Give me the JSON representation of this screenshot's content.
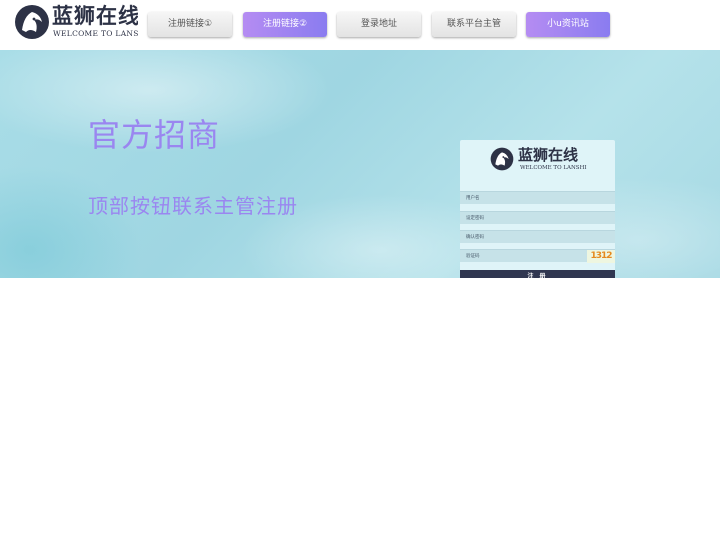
{
  "header": {
    "logo": {
      "title": "蓝狮在线",
      "subtitle": "WELCOME TO LANSHI"
    },
    "nav": [
      {
        "label": "注册链接①",
        "style": "gray"
      },
      {
        "label": "注册链接②",
        "style": "purple"
      },
      {
        "label": "登录地址",
        "style": "gray"
      },
      {
        "label": "联系平台主管",
        "style": "gray"
      },
      {
        "label": "小u资讯站",
        "style": "purple"
      }
    ]
  },
  "hero": {
    "title": "官方招商",
    "subtitle": "顶部按钮联系主管注册"
  },
  "form": {
    "logo": {
      "title": "蓝狮在线",
      "subtitle": "WELCOME TO LANSHI"
    },
    "fields": [
      {
        "placeholder": "用户名"
      },
      {
        "placeholder": "设定密码"
      },
      {
        "placeholder": "确认密码"
      },
      {
        "placeholder": "验证码"
      }
    ],
    "captcha": "1312",
    "submit_label": "注 册"
  },
  "colors": {
    "accent_purple": "#9a86f0",
    "dark_navy": "#2f3650",
    "hero_teal": "#a9dde7"
  }
}
